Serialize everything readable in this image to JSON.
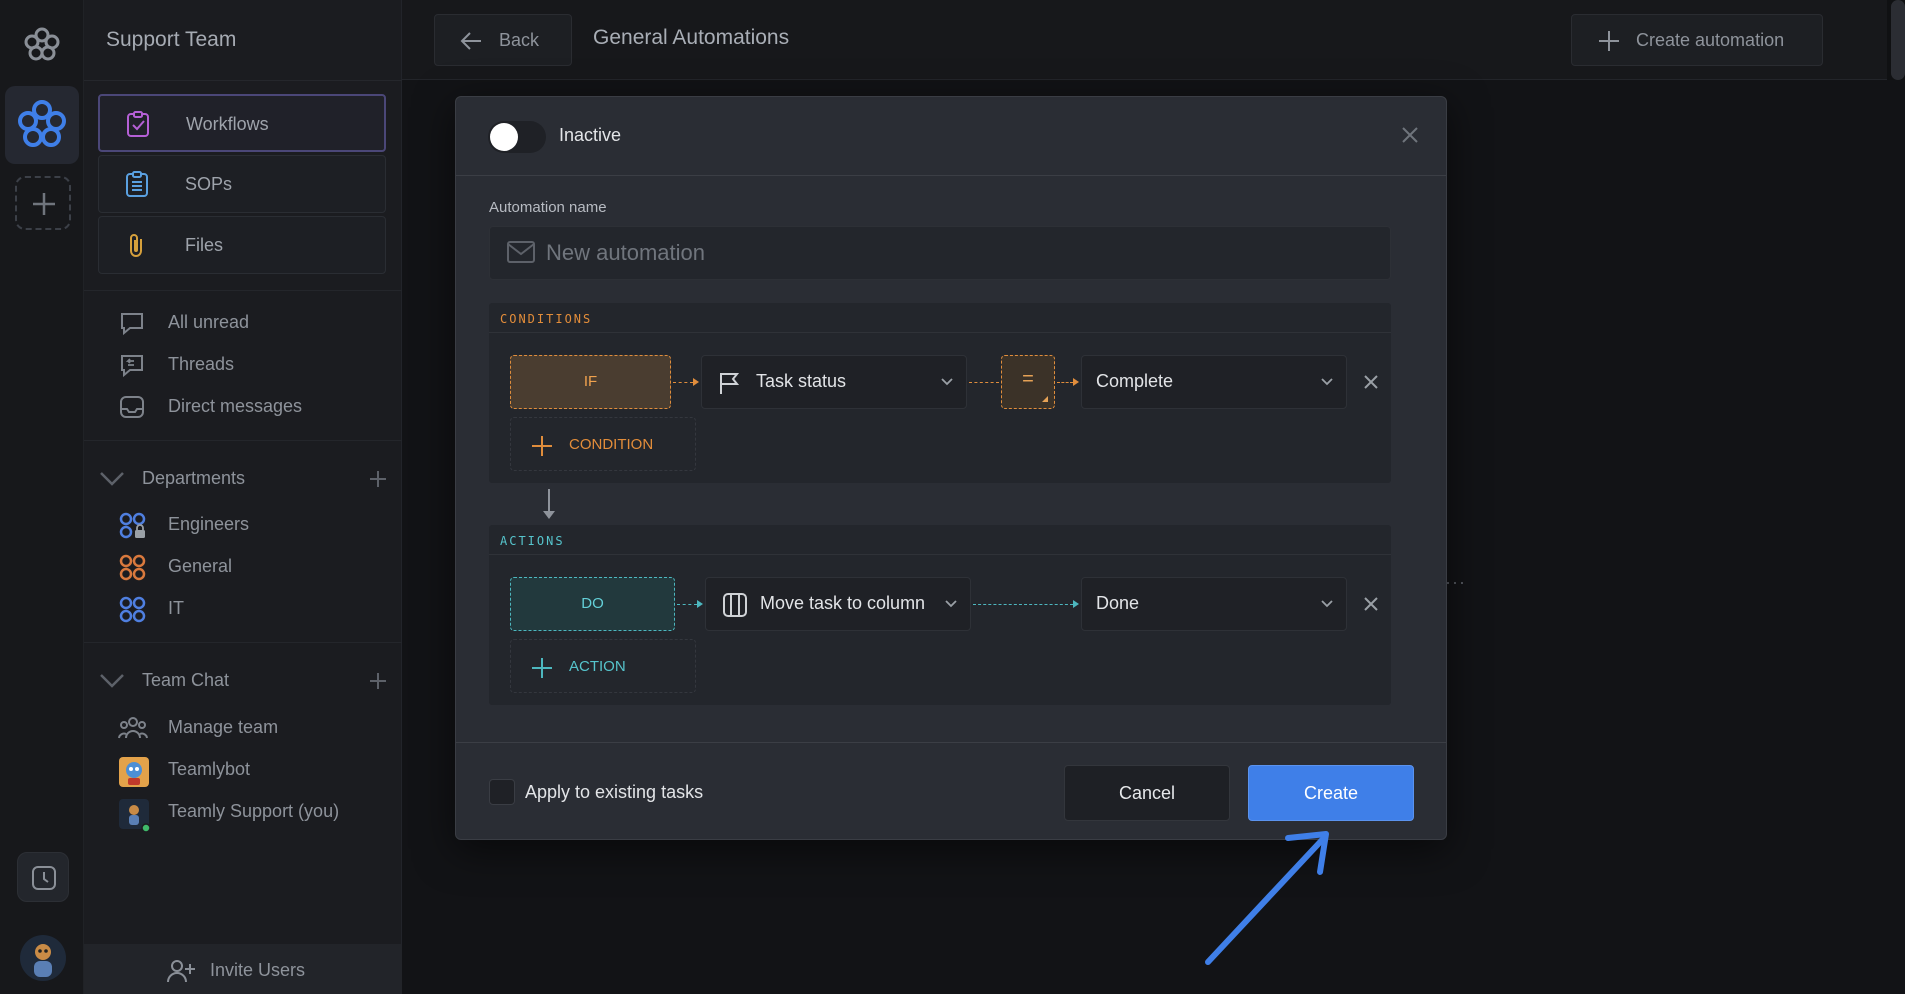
{
  "sidebar": {
    "team_name": "Support Team",
    "nav_cards": [
      {
        "label": "Workflows",
        "icon": "clipboard-check-icon"
      },
      {
        "label": "SOPs",
        "icon": "list-doc-icon"
      },
      {
        "label": "Files",
        "icon": "paperclip-icon"
      }
    ],
    "inbox": [
      {
        "label": "All unread",
        "icon": "chat-bubble-icon"
      },
      {
        "label": "Threads",
        "icon": "threads-icon"
      },
      {
        "label": "Direct messages",
        "icon": "inbox-icon"
      }
    ],
    "departments": {
      "title": "Departments",
      "items": [
        {
          "label": "Engineers",
          "icon": "locked-grid-icon"
        },
        {
          "label": "General",
          "icon": "grid-icon"
        },
        {
          "label": "IT",
          "icon": "grid-icon"
        }
      ]
    },
    "team_chat": {
      "title": "Team Chat",
      "items": [
        {
          "label": "Manage team",
          "icon": "people-icon"
        },
        {
          "label": "Teamlybot",
          "icon": "bot-avatar"
        },
        {
          "label": "Teamly Support (you)",
          "icon": "user-avatar"
        }
      ]
    },
    "invite_label": "Invite Users"
  },
  "topbar": {
    "back_label": "Back",
    "title": "General Automations",
    "create_label": "Create automation"
  },
  "modal": {
    "status_label": "Inactive",
    "name_label": "Automation name",
    "name_placeholder": "New automation",
    "conditions": {
      "header": "CONDITIONS",
      "if_label": "IF",
      "field": "Task status",
      "operator": "=",
      "value": "Complete",
      "add_label": "CONDITION"
    },
    "actions": {
      "header": "ACTIONS",
      "do_label": "DO",
      "action": "Move task to column",
      "target": "Done",
      "add_label": "ACTION"
    },
    "apply_label": "Apply to existing tasks",
    "cancel_label": "Cancel",
    "create_label": "Create"
  },
  "colors": {
    "accent_blue": "#3f7fe8",
    "condition_orange": "#e08d3c",
    "action_teal": "#4db7bf",
    "workflow_purple": "#b560d6"
  }
}
